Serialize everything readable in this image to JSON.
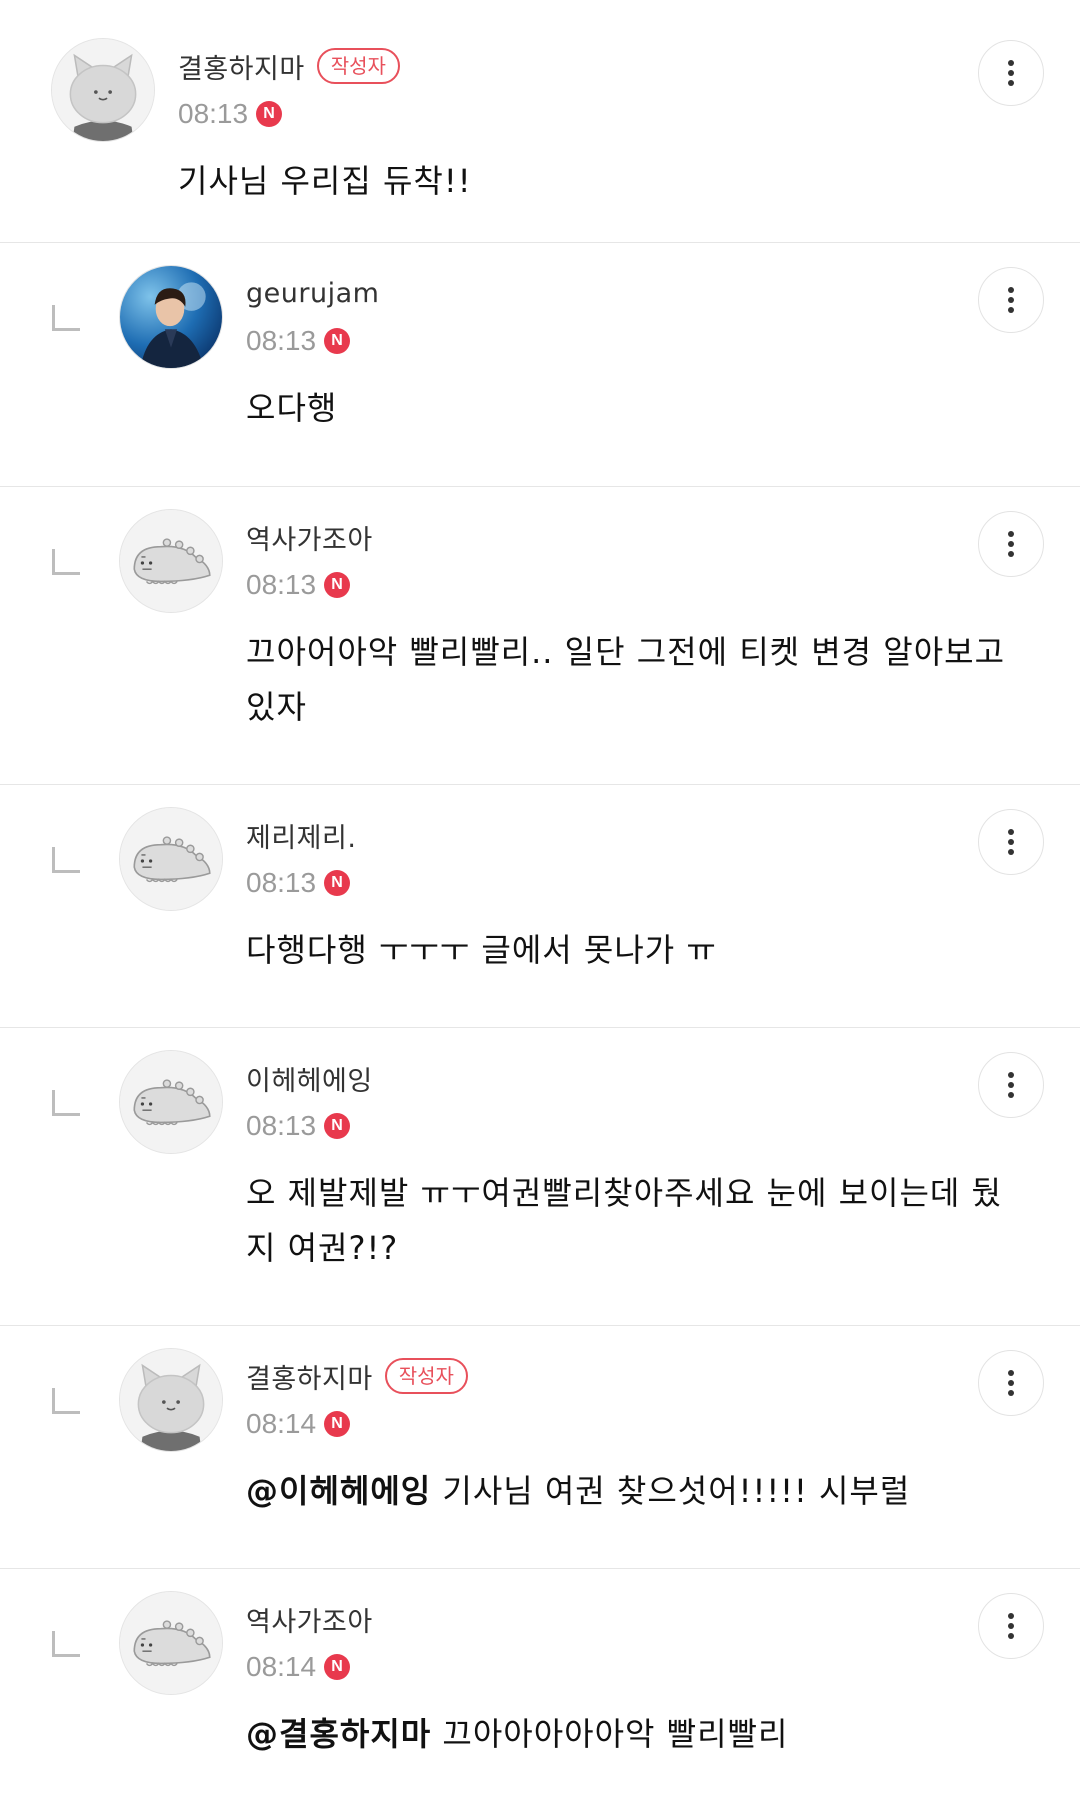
{
  "comments": [
    {
      "nickname": "결홍하지마",
      "badge": "작성자",
      "time": "08:13",
      "new_label": "N",
      "mention": "",
      "text": "기사님 우리집 듀착!!",
      "avatar_icon": "cat-avatar-icon",
      "is_reply": false
    },
    {
      "nickname": "geurujam",
      "badge": "",
      "time": "08:13",
      "new_label": "N",
      "mention": "",
      "text": "오다행",
      "avatar_icon": "profile-photo",
      "is_reply": true
    },
    {
      "nickname": "역사가조아",
      "badge": "",
      "time": "08:13",
      "new_label": "N",
      "mention": "",
      "text": "끄아어아악 빨리빨리.. 일단 그전에 티켓 변경 알아보고있자",
      "avatar_icon": "dino-avatar-icon",
      "is_reply": true
    },
    {
      "nickname": "제리제리.",
      "badge": "",
      "time": "08:13",
      "new_label": "N",
      "mention": "",
      "text": "다행다행 ㅜㅜㅜ 글에서 못나가 ㅠ",
      "avatar_icon": "dino-avatar-icon",
      "is_reply": true
    },
    {
      "nickname": "이헤헤에잉",
      "badge": "",
      "time": "08:13",
      "new_label": "N",
      "mention": "",
      "text": "오 제발제발 ㅠㅜ여권빨리찾아주세요 눈에 보이는데 뒀지 여권?!?",
      "avatar_icon": "dino-avatar-icon",
      "is_reply": true
    },
    {
      "nickname": "결홍하지마",
      "badge": "작성자",
      "time": "08:14",
      "new_label": "N",
      "mention": "@이헤헤에잉",
      "text": "기사님 여권 찾으섯어!!!!! 시부럴",
      "avatar_icon": "cat-avatar-icon",
      "is_reply": true
    },
    {
      "nickname": "역사가조아",
      "badge": "",
      "time": "08:14",
      "new_label": "N",
      "mention": "@결홍하지마",
      "text": "끄아아아아아악 빨리빨리",
      "avatar_icon": "dino-avatar-icon",
      "is_reply": true
    }
  ],
  "colors": {
    "new_badge": "#e8394d",
    "author_badge": "#e8505b",
    "divider": "#e6e6e6"
  }
}
